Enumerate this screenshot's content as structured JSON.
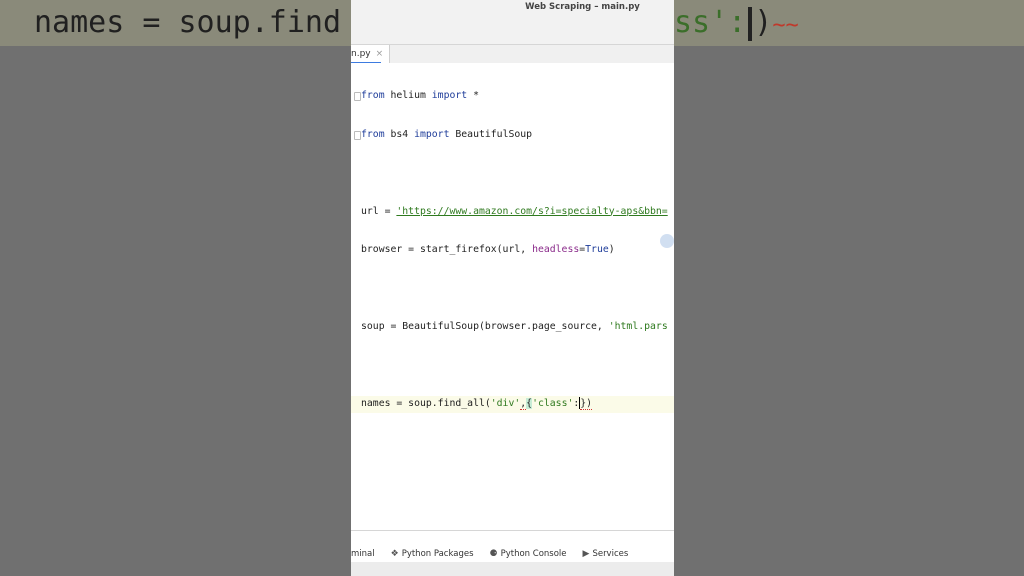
{
  "window": {
    "title": "Web Scraping – main.py"
  },
  "tab": {
    "label": "n.py",
    "close": "×"
  },
  "background": {
    "left_code": "names = soup.find",
    "right_code": "ss':"
  },
  "code": {
    "l1": {
      "kw1": "from",
      "mod": " helium ",
      "kw2": "import",
      "rest": " *"
    },
    "l2": {
      "kw1": "from",
      "mod": " bs4 ",
      "kw2": "import",
      "rest": " BeautifulSoup"
    },
    "l4": {
      "pre": "url = ",
      "str": "'https://www.amazon.com/s?i=specialty-aps&bbn="
    },
    "l5": {
      "pre": "browser = start_firefox(url, ",
      "param": "headless",
      "eq": "=",
      "bool": "True",
      "post": ")"
    },
    "l7": {
      "pre": "soup = BeautifulSoup(browser.page_source, ",
      "str": "'html.pars"
    },
    "l9": {
      "pre": "names = soup.find_all(",
      "str1": "'div'",
      "comma": ",",
      "brace": "{",
      "str2": "'class'",
      "colon": ":",
      "close": "})"
    }
  },
  "statusbar": {
    "terminal": "minal",
    "packages": "Python Packages",
    "console": "Python Console",
    "services": "Services"
  }
}
